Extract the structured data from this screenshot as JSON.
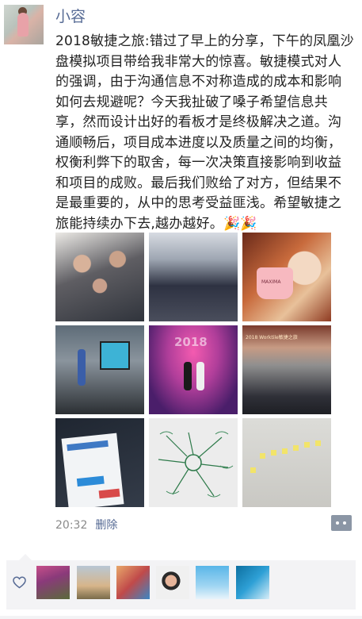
{
  "post": {
    "author": "小容",
    "text": "2018敏捷之旅:错过了早上的分享，下午的凤凰沙盘模拟项目带给我非常大的惊喜。敏捷模式对人的强调，由于沟通信息不对称造成的成本和影响如何去规避呢？今天我扯破了嗓子希望信息共享，然而设计出好的看板才是终极解决之道。沟通顺畅后，项目成本进度以及质量之间的均衡，权衡利弊下的取舍，每一次决策直接影响到收益和项目的成败。最后我们败给了对方，但结果不是最重要的，从中的思考受益匪浅。希望敏捷之旅能持续办下去,越办越好。🎉🎉",
    "photo_texts": {
      "cup_label": "MAXIMA",
      "stage_watermark": "2018",
      "hall_banner": "2018 Worktile敏捷之旅"
    },
    "time": "20:32",
    "delete_label": "删除"
  },
  "icons": {
    "more": "more-dots-icon",
    "like": "heart-icon"
  },
  "colors": {
    "link": "#576b95",
    "meta": "#8a8a8a",
    "likes_bg": "#f3f3f5"
  }
}
